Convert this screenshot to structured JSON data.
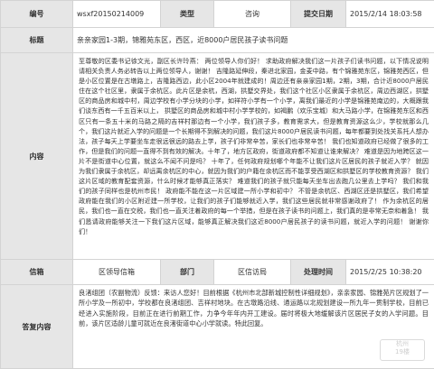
{
  "row1": {
    "number_label": "编号",
    "number_value": "wsxf20150214009",
    "type_label": "类型",
    "type_value": "咨询",
    "submit_date_label": "提交日期",
    "submit_date_value": "2015/2/14 18:03:58"
  },
  "row2": {
    "title_label": "标题",
    "title_value": "亲亲家园1-3期，锦雅苑东区，西区，近8000户居民孩子读书问题"
  },
  "row3": {
    "content_label": "内容",
    "content_value": "至尊敬的区委书记徐文光，副区长许玲燕： 两位领导人你们好！ 求助政府解决我们这一片孩子们读书问题，以下情况说明请相关负责人务必转告以上两位领导人，谢谢！ 吉隆路延伸段，秦进北家园，金麦中路，有个锦雅苑东区，锦雅苑西区，但是小区位置是在古墩路上，吉隆路西边，此小区2004年就建成的！周边还有亲亲家园1期，2期，3期，合计近8000户居民住在这个社区里，隶属于余杭区。此片区是余杭，西湖，拱墅交界处，我们这个社区小区隶属于余杭区，周边西湖区，拱墅区的商品房和城中村，周边学校有小学分块的小学，如祥符小学有一个小学，离我们最近的小学是锦雅苑南边的，大概跟我们谈东西有一千五百米以上， 拱墅区的商品房和城中村小学学校的，如褐鹏（欢乐宝城）和大马路小学，在锦雅苑东区和西区只有一条五十米的马路之隔的吉祥村那边有一个小学，我们孩子多，教育需求大，但是教育资源这么少，学校就那么几个，我们这片就近入学的问题是一个长期得不到解决的问题，我们这片8000户居民读书问题，每年都要到处找关系托人想办法，孩子每天上学要坐车走很远很远的路去上学，孩子们非常辛苦，家长们也非常辛苦！ 我们也知道政府已经做了很多的工作，但是我们的问题一直得不到有效的解决。十年了，地方区政府，街道政府都不知道让谁来解决？ 难道是因为地跨区这一片不是街道中心位置，就这么不闻不问是吗？ 十年了，任何政府规划哪个年能不让我们这片区居民的孩子就近入学？ 就因为我们隶属于余杭区，却远离余杭区的中心，就因为我们的户籍在余杭区而不能享受西湖区和拱墅区的学校教育资源？ 我们这片区域的教育配套资源，什么时候才能够真正落实？ 难道我们的孩子就只能每天坐车出去跑几公里去上学吗？ 我们和我们的孩子同样也是杭州市民！ 政府能不能在这一片区域建一所小学和初中？ 不管是余杭区、西湖区还是拱墅区，我们希望政府能在我们的小区附近建一所学校，让我们的孩子们能够就近入学，我们这些居民就非常感谢政府了！ 作为余杭区的居民，我们也一直在交税，我们也一直关注着政府的每一个举措，但是在孩子读书的问题上，我们真的是非常无奈和着急！ 我们恳请政府能够关注一下我们这片区域，能够真正解决我们这近8000户居民孩子的读书问题，就近入学的问题！ 谢谢你们！"
  },
  "row4": {
    "letter_label": "信箱",
    "letter_value": "区领导信箱",
    "dept_label": "部门",
    "dept_value": "区信访局",
    "handle_date_label": "处理时间",
    "handle_date_value": "2015/2/25 10:38:20"
  },
  "row5": {
    "reply_label": "答复内容",
    "reply_value": "良渚组团（农副物流）反馈：来访人您好！目前根据《杭州市北部新城控制性详细规划》，亲亲家园、锦雅苑片区规划了一所小学及一所初中，学校都在良渚组团、吉祥村地块。在古墩路沿线、通运路以北规划建设一所九年一贯制学校，目前已经进入实施阶段，目前正在进行前期工作，力争今年年内开工建设。届时将极大地缓解该片区居民子女的入学问题。目前，该片区适龄儿童可就近在良渚街道中心小学就读。特此回复。"
  },
  "watermark": {
    "line1": "杭州",
    "line2": "19楼"
  }
}
